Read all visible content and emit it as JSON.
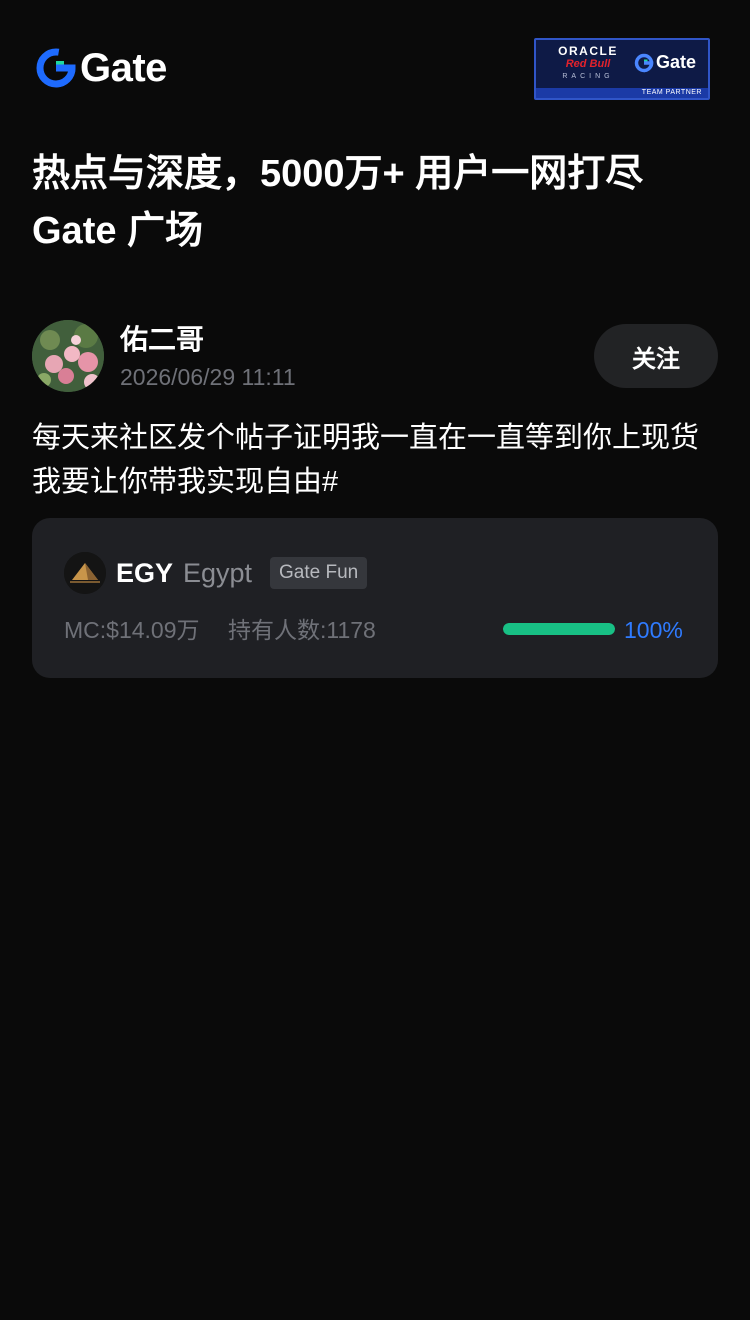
{
  "header": {
    "logo_text": "Gate",
    "partner": {
      "line1": "ORACLE",
      "line2": "Red Bull",
      "line3": "RACING",
      "brand": "Gate",
      "strip": "TEAM PARTNER"
    }
  },
  "hero": {
    "line1": "热点与深度，5000万+ 用户一网打尽",
    "line2": "Gate 广场"
  },
  "post": {
    "author": "佑二哥",
    "timestamp": "2026/06/29 11:11",
    "follow_label": "关注",
    "body": "每天来社区发个帖子证明我一直在一直等到你上现货我要让你带我实现自由#"
  },
  "token": {
    "symbol": "EGY",
    "name": "Egypt",
    "tag": "Gate Fun",
    "market_cap": "MC:$14.09万",
    "holders": "持有人数:1178",
    "progress_label": "100%",
    "progress_value": 1.0
  },
  "colors": {
    "background": "#0a0a0a",
    "accent_blue": "#2f7bff",
    "progress_green": "#18c085",
    "card": "#1f2024"
  }
}
